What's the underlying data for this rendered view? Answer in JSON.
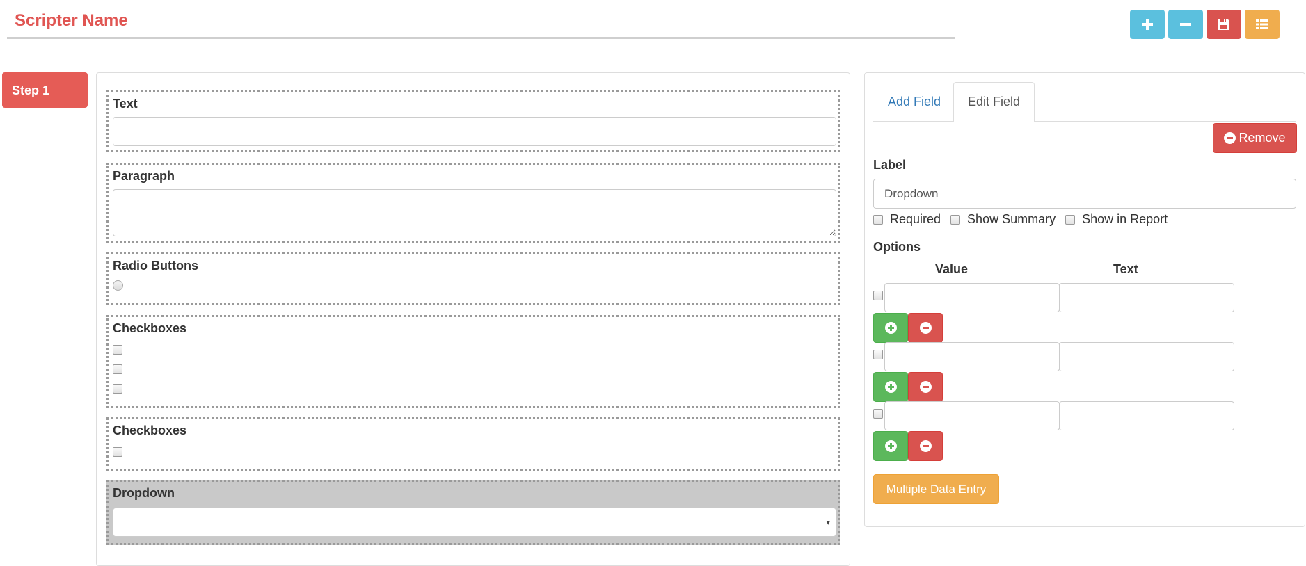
{
  "header": {
    "title_value": "Scripter Name",
    "toolbar": [
      {
        "icon": "plus-icon",
        "color": "#5bc0de"
      },
      {
        "icon": "minus-icon",
        "color": "#5bc0de"
      },
      {
        "icon": "floppy-disk-icon",
        "color": "#d9534f"
      },
      {
        "icon": "list-icon",
        "color": "#f0ad4e"
      }
    ]
  },
  "steps": [
    {
      "label": "Step 1",
      "color": "#e55c56",
      "active": true
    }
  ],
  "form": {
    "fields": [
      {
        "type": "text",
        "label": "Text"
      },
      {
        "type": "paragraph",
        "label": "Paragraph"
      },
      {
        "type": "radio",
        "label": "Radio Buttons",
        "options": 1
      },
      {
        "type": "checkbox",
        "label": "Checkboxes",
        "options": 3
      },
      {
        "type": "checkbox",
        "label": "Checkboxes",
        "options": 1
      },
      {
        "type": "dropdown",
        "label": "Dropdown",
        "selected": true,
        "caret": "▾"
      }
    ]
  },
  "panel": {
    "tabs": [
      {
        "label": "Add Field",
        "active": false
      },
      {
        "label": "Edit Field",
        "active": true
      }
    ],
    "remove_label": "Remove",
    "label_title": "Label",
    "label_value": "Dropdown",
    "checkboxes": [
      {
        "label": "Required",
        "checked": false
      },
      {
        "label": "Show Summary",
        "checked": false
      },
      {
        "label": "Show in Report",
        "checked": false
      }
    ],
    "options_title": "Options",
    "value_header": "Value",
    "text_header": "Text",
    "options": [
      {
        "value": "",
        "text": ""
      },
      {
        "value": "",
        "text": ""
      },
      {
        "value": "",
        "text": ""
      }
    ],
    "multiple_entry_label": "Multiple Data Entry"
  },
  "colors": {
    "title": "#e05552",
    "success": "#5cb85c",
    "danger": "#d9534f",
    "warning": "#f0ad4e",
    "info": "#5bc0de",
    "link": "#337ab7",
    "selected_field_bg": "#c9c9c9"
  }
}
